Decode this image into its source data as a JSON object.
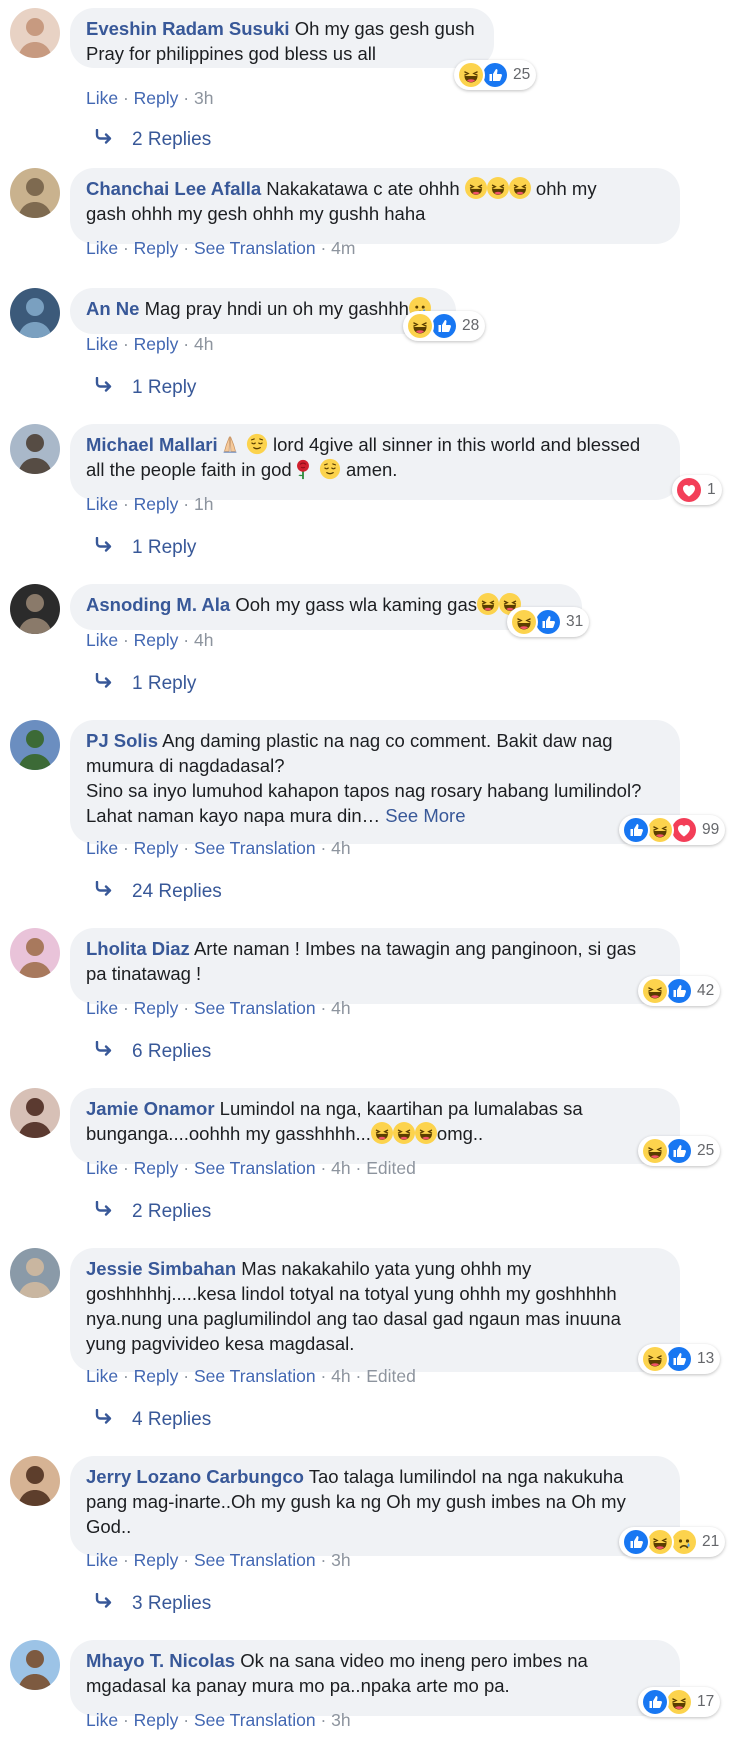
{
  "colors": {
    "author": "#385898",
    "link": "#4267b2",
    "bubble": "#f0f2f5",
    "meta": "#8d949e",
    "like_blue": "#1877f2",
    "love_red": "#f33e58",
    "haha_yellow": "#fcd34d"
  },
  "actions": {
    "like": "Like",
    "reply": "Reply",
    "see_translation": "See Translation",
    "edited": "Edited",
    "sep": " · "
  },
  "comments": [
    {
      "author": "Eveshin Radam Susuki",
      "text_parts": [
        "Oh my gas gesh gush",
        "Pray for philippines god bless us all"
      ],
      "time": "3h",
      "reactions": [
        "haha-icon",
        "like-icon"
      ],
      "reaction_count": "25",
      "replies_label": "2 Replies"
    },
    {
      "author": "Chanchai Lee Afalla",
      "text_parts": [
        "Nakakatawa c ate ohhh",
        "ohh my",
        "gash ohhh my gesh ohhh my gushh haha"
      ],
      "time": "4m",
      "inline_emoji": [
        "laugh-cry-emoji",
        "laugh-cry-emoji",
        "laugh-cry-emoji"
      ]
    },
    {
      "author": "An Ne",
      "text_parts": [
        "Mag pray hndi un oh my gashhh"
      ],
      "inline_emoji": [
        "sad-emoji"
      ],
      "time": "4h",
      "reactions": [
        "haha-icon",
        "like-icon"
      ],
      "reaction_count": "28",
      "replies_label": "1 Reply"
    },
    {
      "author": "Michael Mallari",
      "text_parts": [
        "lord 4give all sinner in this world and blessed",
        "all the people faith in god",
        "amen."
      ],
      "inline_emoji": [
        "praying-hands-emoji",
        "relieved-face-emoji",
        "rose-emoji",
        "relieved-face-emoji"
      ],
      "time": "1h",
      "reactions": [
        "love-icon"
      ],
      "reaction_count": "1",
      "replies_label": "1 Reply"
    },
    {
      "author": "Asnoding M. Ala",
      "text_parts": [
        "Ooh my gass wla kaming gas"
      ],
      "inline_emoji": [
        "laugh-cry-emoji",
        "laugh-cry-emoji"
      ],
      "time": "4h",
      "reactions": [
        "haha-icon",
        "like-icon"
      ],
      "reaction_count": "31",
      "replies_label": "1 Reply"
    },
    {
      "author": "PJ Solis",
      "text_parts": [
        "Ang daming plastic na nag co comment. Bakit daw nag",
        "mumura di nagdadasal?",
        "Sino sa inyo lumuhod kahapon tapos nag rosary habang lumilindol?",
        "Lahat naman kayo napa mura din…"
      ],
      "see_more": "See More",
      "time": "4h",
      "reactions": [
        "like-icon",
        "haha-icon",
        "love-icon"
      ],
      "reaction_count": "99",
      "replies_label": "24 Replies"
    },
    {
      "author": "Lholita Diaz",
      "text_parts": [
        "Arte naman ! Imbes na tawagin ang panginoon, si gas",
        "pa tinatawag !"
      ],
      "time": "4h",
      "reactions": [
        "haha-icon",
        "like-icon"
      ],
      "reaction_count": "42",
      "replies_label": "6 Replies"
    },
    {
      "author": "Jamie Onamor",
      "text_parts": [
        "Lumindol na nga, kaartihan pa lumalabas sa",
        "bunganga....oohhh my gasshhhh...",
        "omg.."
      ],
      "inline_emoji": [
        "laugh-cry-emoji",
        "laugh-cry-emoji",
        "laugh-cry-emoji"
      ],
      "time": "4h",
      "reactions": [
        "haha-icon",
        "like-icon"
      ],
      "reaction_count": "25",
      "replies_label": "2 Replies"
    },
    {
      "author": "Jessie Simbahan",
      "text_parts": [
        "Mas nakakahilo yata yung ohhh my",
        "goshhhhhj.....kesa lindol totyal na totyal yung ohhh my goshhhhh",
        "nya.nung una paglumilindol ang tao dasal gad ngaun mas inuuna",
        "yung pagvivideo kesa magdasal."
      ],
      "time": "4h",
      "reactions": [
        "haha-icon",
        "like-icon"
      ],
      "reaction_count": "13",
      "replies_label": "4 Replies"
    },
    {
      "author": "Jerry Lozano Carbungco",
      "text_parts": [
        "Tao talaga lumilindol na nga nakukuha",
        "pang mag-inarte..Oh my gush ka ng Oh my gush imbes na Oh my",
        "God.."
      ],
      "time": "3h",
      "reactions": [
        "like-icon",
        "haha-icon",
        "sad-icon"
      ],
      "reaction_count": "21",
      "replies_label": "3 Replies"
    },
    {
      "author": "Mhayo T. Nicolas",
      "text_parts": [
        "Ok na sana video mo ineng pero imbes na",
        "mgadasal ka panay mura mo pa..npaka arte mo pa."
      ],
      "time": "3h",
      "reactions": [
        "like-icon",
        "haha-icon"
      ],
      "reaction_count": "17"
    }
  ]
}
